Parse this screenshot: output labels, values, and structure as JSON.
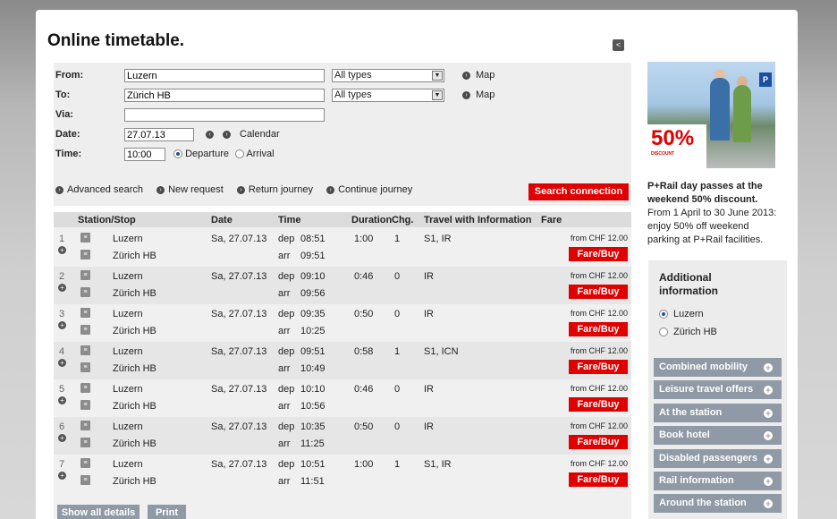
{
  "page": {
    "title": "Online timetable."
  },
  "form": {
    "from_label": "From:",
    "from_value": "Luzern",
    "from_type": "All types",
    "to_label": "To:",
    "to_value": "Zürich HB",
    "to_type": "All types",
    "via_label": "Via:",
    "via_value": "",
    "date_label": "Date:",
    "date_value": "27.07.13",
    "calendar_label": "Calendar",
    "time_label": "Time:",
    "time_value": "10:00",
    "departure_label": "Departure",
    "arrival_label": "Arrival",
    "map_label": "Map",
    "links": {
      "advanced": "Advanced search",
      "new_request": "New request",
      "return_journey": "Return journey",
      "continue_journey": "Continue journey"
    },
    "search_button": "Search connection"
  },
  "results": {
    "headers": {
      "station": "Station/Stop",
      "date": "Date",
      "time": "Time",
      "duration": "Duration",
      "changes": "Chg.",
      "travel_with": "Travel with",
      "information": "Information",
      "fare": "Fare"
    },
    "connections": [
      {
        "num": "1",
        "from": "Luzern",
        "to": "Zürich HB",
        "date": "Sa, 27.07.13",
        "dep_label": "dep",
        "dep": "08:51",
        "arr_label": "arr",
        "arr": "09:51",
        "duration": "1:00",
        "changes": "1",
        "travel": "S1, IR",
        "fare": "from CHF 12.00",
        "fare_btn": "Fare/Buy"
      },
      {
        "num": "2",
        "from": "Luzern",
        "to": "Zürich HB",
        "date": "Sa, 27.07.13",
        "dep_label": "dep",
        "dep": "09:10",
        "arr_label": "arr",
        "arr": "09:56",
        "duration": "0:46",
        "changes": "0",
        "travel": "IR",
        "fare": "from CHF 12.00",
        "fare_btn": "Fare/Buy"
      },
      {
        "num": "3",
        "from": "Luzern",
        "to": "Zürich HB",
        "date": "Sa, 27.07.13",
        "dep_label": "dep",
        "dep": "09:35",
        "arr_label": "arr",
        "arr": "10:25",
        "duration": "0:50",
        "changes": "0",
        "travel": "IR",
        "fare": "from CHF 12.00",
        "fare_btn": "Fare/Buy"
      },
      {
        "num": "4",
        "from": "Luzern",
        "to": "Zürich HB",
        "date": "Sa, 27.07.13",
        "dep_label": "dep",
        "dep": "09:51",
        "arr_label": "arr",
        "arr": "10:49",
        "duration": "0:58",
        "changes": "1",
        "travel": "S1, ICN",
        "fare": "from CHF 12.00",
        "fare_btn": "Fare/Buy"
      },
      {
        "num": "5",
        "from": "Luzern",
        "to": "Zürich HB",
        "date": "Sa, 27.07.13",
        "dep_label": "dep",
        "dep": "10:10",
        "arr_label": "arr",
        "arr": "10:56",
        "duration": "0:46",
        "changes": "0",
        "travel": "IR",
        "fare": "from CHF 12.00",
        "fare_btn": "Fare/Buy"
      },
      {
        "num": "6",
        "from": "Luzern",
        "to": "Zürich HB",
        "date": "Sa, 27.07.13",
        "dep_label": "dep",
        "dep": "10:35",
        "arr_label": "arr",
        "arr": "11:25",
        "duration": "0:50",
        "changes": "0",
        "travel": "IR",
        "fare": "from CHF 12.00",
        "fare_btn": "Fare/Buy"
      },
      {
        "num": "7",
        "from": "Luzern",
        "to": "Zürich HB",
        "date": "Sa, 27.07.13",
        "dep_label": "dep",
        "dep": "10:51",
        "arr_label": "arr",
        "arr": "11:51",
        "duration": "1:00",
        "changes": "1",
        "travel": "S1, IR",
        "fare": "from CHF 12.00",
        "fare_btn": "Fare/Buy"
      }
    ],
    "show_all_details": "Show all details",
    "print": "Print"
  },
  "ad": {
    "discount": "50%",
    "discount_small": "DISCOUNT",
    "headline": "P+Rail day passes at the weekend 50% discount.",
    "body": "From 1 April to 30 June 2013: enjoy 50% off weekend parking at P+Rail facilities.",
    "parking_sign": "P"
  },
  "additional": {
    "title": "Additional information",
    "stations": [
      "Luzern",
      "Zürich HB"
    ],
    "buttons": [
      "Combined mobility",
      "Leisure travel offers",
      "At the station",
      "Book hotel",
      "Disabled passengers",
      "Rail information",
      "Around the station"
    ]
  },
  "colors": {
    "accent_red": "#e10000",
    "button_gray": "#8f9aa6"
  },
  "icons": {
    "share": "share-icon",
    "arrow": "arrow-right-icon",
    "expand": "plus-circle-icon",
    "station": "station-info-icon"
  }
}
